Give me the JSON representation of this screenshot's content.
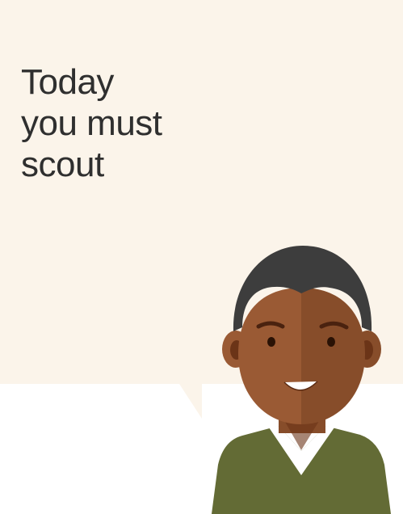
{
  "message": {
    "lines": [
      "Today",
      "you must",
      "scout"
    ]
  },
  "colors": {
    "bubble": "#fbf4ea",
    "page": "#ffffff",
    "text": "#2f2f2f",
    "hair": "#3d3d3d",
    "skin_light": "#9a5a34",
    "skin_dark": "#874d2a",
    "ear_inner": "#6b3417",
    "eyebrow": "#4a220f",
    "eye": "#2a1205",
    "sweater": "#636b35",
    "collar": "#ffffff",
    "teeth": "#ffffff"
  },
  "icons": {
    "bubble": "speech-bubble-icon",
    "person": "smiling-person-avatar-icon"
  }
}
